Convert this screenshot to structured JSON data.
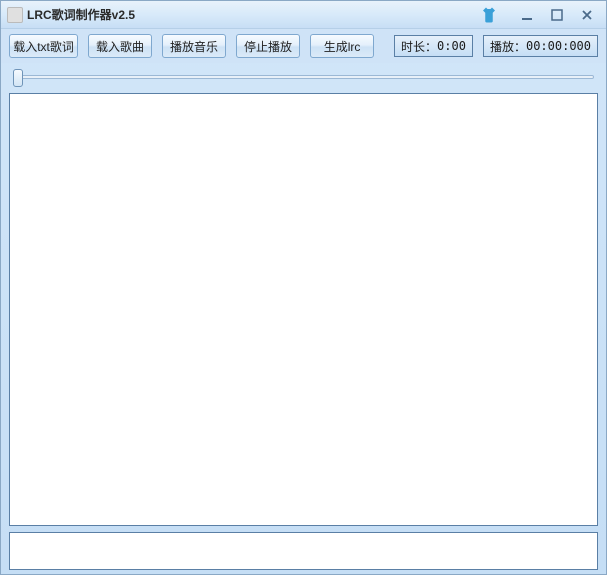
{
  "window": {
    "title": "LRC歌词制作器v2.5"
  },
  "toolbar": {
    "load_txt": "载入txt歌词",
    "load_song": "载入歌曲",
    "play": "播放音乐",
    "stop": "停止播放",
    "generate": "生成lrc"
  },
  "info": {
    "duration_label": "时长：",
    "duration_value": "0:00",
    "position_label": "播放：",
    "position_value": "00:00:000"
  },
  "slider": {
    "value": 0,
    "min": 0,
    "max": 100
  },
  "lyrics_text": "",
  "status_text": ""
}
